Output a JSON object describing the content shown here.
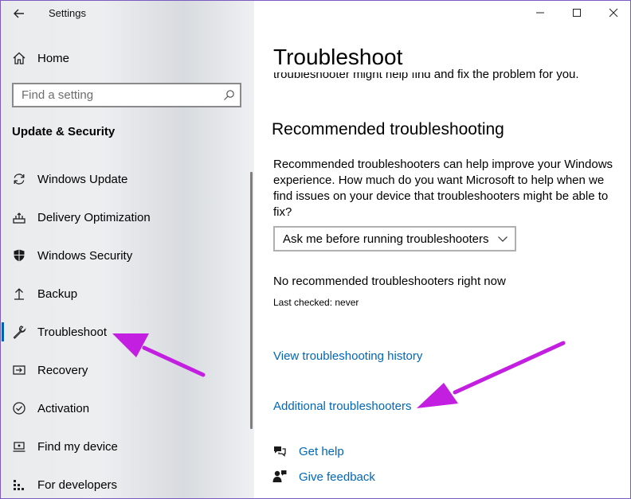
{
  "window": {
    "title": "Settings"
  },
  "sidebar": {
    "home_label": "Home",
    "search_placeholder": "Find a setting",
    "section_title": "Update & Security",
    "items": [
      {
        "label": "Windows Update",
        "icon": "sync-icon"
      },
      {
        "label": "Delivery Optimization",
        "icon": "delivery-optimization-icon"
      },
      {
        "label": "Windows Security",
        "icon": "shield-icon"
      },
      {
        "label": "Backup",
        "icon": "backup-icon"
      },
      {
        "label": "Troubleshoot",
        "icon": "wrench-icon",
        "selected": true
      },
      {
        "label": "Recovery",
        "icon": "recovery-icon"
      },
      {
        "label": "Activation",
        "icon": "check-circle-icon"
      },
      {
        "label": "Find my device",
        "icon": "find-device-icon"
      },
      {
        "label": "For developers",
        "icon": "developer-icon"
      }
    ]
  },
  "main": {
    "title": "Troubleshoot",
    "cut_text": "troubleshooter might help find and fix the problem for you.",
    "recommended_heading": "Recommended troubleshooting",
    "recommended_description": "Recommended troubleshooters can help improve your Windows experience. How much do you want Microsoft to help when we find issues on your device that troubleshooters might be able to fix?",
    "dropdown_value": "Ask me before running troubleshooters",
    "no_recommended": "No recommended troubleshooters right now",
    "last_checked": "Last checked: never",
    "history_link": "View troubleshooting history",
    "additional_link": "Additional troubleshooters",
    "get_help": "Get help",
    "give_feedback": "Give feedback"
  },
  "colors": {
    "accent": "#0067b8",
    "annotation_arrow": "#c21fe0",
    "selection_indicator": "#0063b1"
  }
}
